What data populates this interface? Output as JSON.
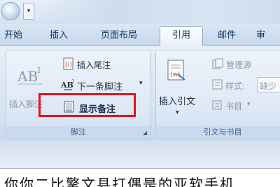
{
  "tabs": [
    {
      "label": "开始"
    },
    {
      "label": "插入"
    },
    {
      "label": "页面布局"
    },
    {
      "label": "引用",
      "active": true
    },
    {
      "label": "邮件"
    },
    {
      "label": "审"
    }
  ],
  "footnotes_group": {
    "label": "脚注",
    "insert_footnote": {
      "label": "插入脚注",
      "icon": "footnote-ab1-icon"
    },
    "insert_endnote": {
      "label": "插入尾注",
      "icon": "endnote-icon"
    },
    "next_footnote": {
      "label": "下一条脚注",
      "icon": "next-footnote-icon"
    },
    "show_notes": {
      "label": "显示备注",
      "icon": "show-notes-icon"
    }
  },
  "citations_group": {
    "label": "引文与书目",
    "insert_citation": {
      "label": "插入引文",
      "icon": "insert-citation-icon"
    },
    "manage_sources": {
      "label": "管理源",
      "icon": "manage-sources-icon"
    },
    "style": {
      "label": "样式:",
      "value": "缺少",
      "icon": "style-icon"
    },
    "bibliography": {
      "label": "书目",
      "icon": "bibliography-icon"
    }
  },
  "document": {
    "line": "你你二比擎文县打偶是的亚软手机"
  },
  "colors": {
    "highlight_box": "#e0141c",
    "active_tab_bg": "#ffffff",
    "ribbon_bg": "#dde8f5"
  }
}
